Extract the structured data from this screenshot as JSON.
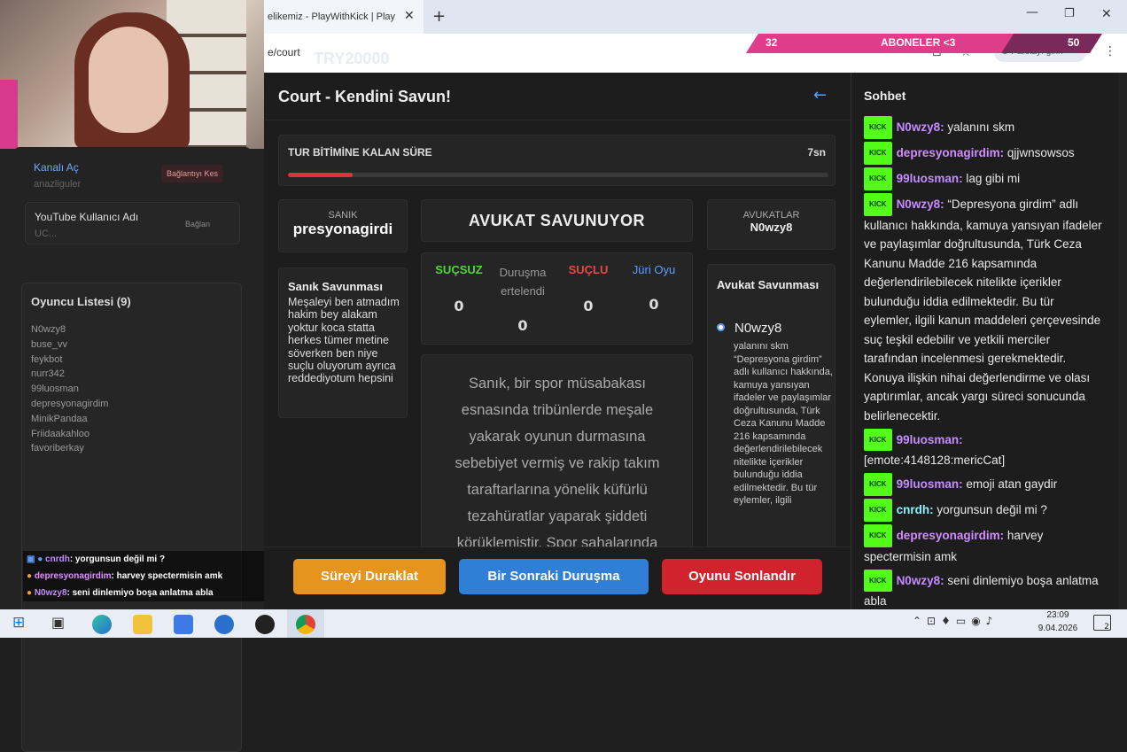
{
  "browser": {
    "tab_title": "elikemiz - PlayWithKick | Play",
    "url": "e/court",
    "overlay_code": "TRY20000",
    "password_placeholder": "Parolayı girin"
  },
  "subscriber_bar": {
    "left": "32",
    "label": "ABONELER <3",
    "right": "50"
  },
  "left_panel": {
    "channel_label": "Kanalı Aç",
    "channel_sub": "anazliguler",
    "disconnect_label": "Bağlantıyı Kes",
    "youtube_label": "YouTube Kullanıcı Adı",
    "youtube_value": "UC...",
    "connect_label": "Bağlan",
    "players_title": "Oyuncu Listesi (9)",
    "players": [
      "N0wzy8",
      "buse_vv",
      "feykbot",
      "nurr342",
      "99luosman",
      "depresyonagirdim",
      "MinikPandaa",
      "Friidaakahloo",
      "favoriberkay"
    ]
  },
  "overlay_chat": [
    {
      "user": "cnrdh",
      "text": ": yorgunsun değil mi ?"
    },
    {
      "user": "depresyonagirdim",
      "text": ": harvey spectermisin amk"
    },
    {
      "user": "N0wzy8",
      "text": ": seni dinlemiyo boşa anlatma abla"
    }
  ],
  "court": {
    "title": "Court - Kendini Savun!",
    "back_arrow": "←",
    "timer_label": "TUR BİTİMİNE KALAN SÜRE",
    "timer_value": "7sn",
    "timer_progress": 0.12,
    "defendant_label": "SANIK",
    "defendant_name": "presyonagirdi",
    "status": "AVUKAT SAVUNUYOR",
    "lawyers_label": "AVUKATLAR",
    "lawyer_name": "N0wzy8",
    "defense_title": "Sanık Savunması",
    "defense_text": "Meşaleyi ben atmadım hakim bey alakam yoktur koca statta herkes tümer metine söverken ben niye suçlu oluyorum ayrıca reddediyotum hepsini",
    "votes": {
      "innocent_label": "SUÇSUZ",
      "innocent": "0",
      "postponed_label": "Duruşma ertelendi",
      "postponed": "0",
      "guilty_label": "SUÇLU",
      "guilty": "0",
      "jury_label": "Jüri Oyu",
      "jury": "0"
    },
    "case_text": "Sanık, bir spor müsabakası esnasında tribünlerde meşale yakarak oyunun durmasına sebebiyet vermiş ve rakip takım taraftarlarına yönelik küfürlü tezahüratlar yaparak şiddeti körüklemiştir. Spor sahalarında",
    "lawyer_defense_title": "Avukat Savunması",
    "lawyer_defense_name": "N0wzy8",
    "lawyer_defense_text": "yalanını skm “Depresyona girdim” adlı kullanıcı hakkında, kamuya yansıyan ifadeler ve paylaşımlar doğrultusunda, Türk Ceza Kanunu Madde 216 kapsamında değerlendirilebilecek nitelikte içerikler bulunduğu iddia edilmektedir. Bu tür eylemler, ilgili",
    "pause_button": "Süreyi Duraklat",
    "next_button": "Bir Sonraki Duruşma",
    "end_button": "Oyunu Sonlandır"
  },
  "chat": {
    "title": "Sohbet",
    "badge": "KICK",
    "messages": [
      {
        "user": "N0wzy8:",
        "text": " yalanını skm",
        "cls": "un"
      },
      {
        "user": "depresyonagirdim:",
        "text": " qjjwnsowsos",
        "cls": "un2"
      },
      {
        "user": "99luosman:",
        "text": " lag gibi mi",
        "cls": "un"
      },
      {
        "user": "N0wzy8:",
        "text": " “Depresyona girdim” adlı kullanıcı hakkında, kamuya yansıyan ifadeler ve paylaşımlar doğrultusunda, Türk Ceza Kanunu Madde 216 kapsamında değerlendirilebilecek nitelikte içerikler bulunduğu iddia edilmektedir. Bu tür eylemler, ilgili kanun maddeleri çerçevesinde suç teşkil edebilir ve yetkili merciler tarafından incelenmesi gerekmektedir. Konuya ilişkin nihai değerlendirme ve olası yaptırımlar, ancak yargı süreci sonucunda belirlenecektir.",
        "cls": "un"
      },
      {
        "user": "99luosman:",
        "text": " [emote:4148128:mericCat]",
        "cls": "un"
      },
      {
        "user": "99luosman:",
        "text": " emoji atan gaydir",
        "cls": "un"
      },
      {
        "user": "cnrdh:",
        "text": " yorgunsun değil mi ?",
        "cls": "un3"
      },
      {
        "user": "depresyonagirdim:",
        "text": " harvey spectermisin amk",
        "cls": "un2"
      },
      {
        "user": "N0wzy8:",
        "text": " seni dinlemiyo boşa anlatma abla",
        "cls": "un"
      }
    ]
  },
  "taskbar": {
    "time": "23:09",
    "date": "9.04.2026",
    "notif_count": "2"
  }
}
